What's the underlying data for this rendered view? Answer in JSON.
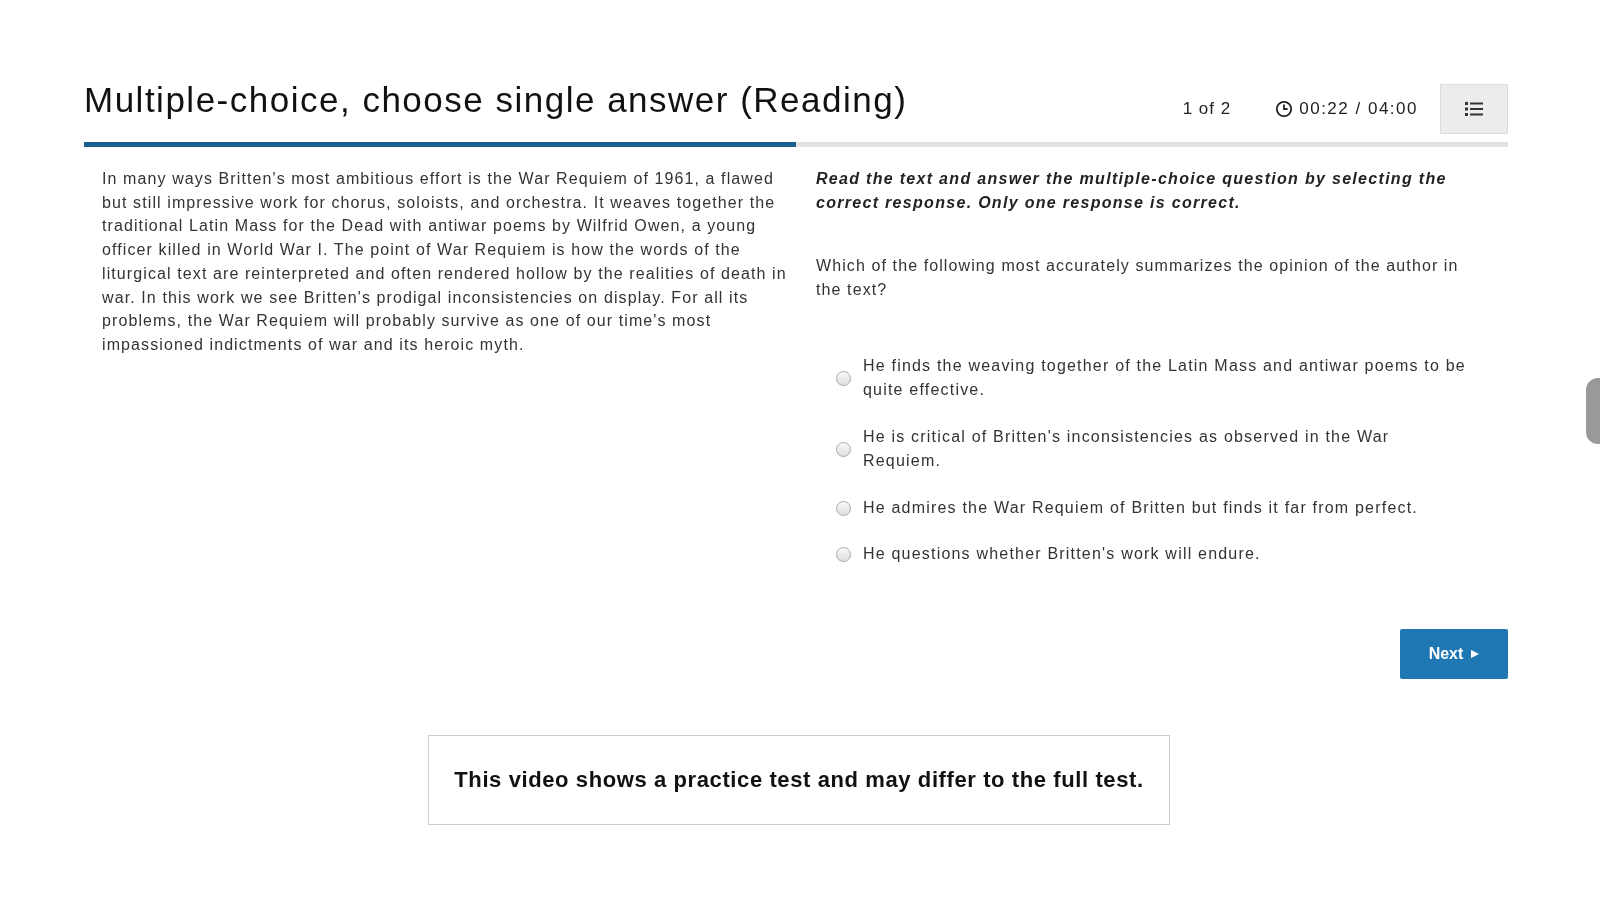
{
  "header": {
    "title": "Multiple-choice, choose single answer (Reading)",
    "counter": "1 of 2",
    "timer": "00:22 / 04:00"
  },
  "progress": {
    "level": 0.5
  },
  "passage": "In many ways Britten's most ambitious effort is the War Requiem of 1961, a flawed but still impressive work for chorus, soloists, and orchestra. It weaves together the traditional Latin Mass for the Dead with antiwar poems by Wilfrid Owen, a young officer killed in World War I. The point of War Requiem is how the words of the liturgical text are reinterpreted and often rendered hollow by the realities of death in war. In this work we see Britten's prodigal inconsistencies on display. For all its problems, the War Requiem will probably survive as one of our time's most impassioned indictments of war and its heroic myth.",
  "instructions": "Read the text and answer the multiple-choice question by selecting the correct response. Only one response is correct.",
  "question": "Which of the following most accurately summarizes the opinion of the author in the text?",
  "options": [
    {
      "label": "He finds the weaving together of the Latin Mass and antiwar poems to be quite effective.",
      "selected": false
    },
    {
      "label": "He is critical of Britten's inconsistencies as observed in the War Requiem.",
      "selected": false
    },
    {
      "label": "He admires the War Requiem of Britten but finds it far from perfect.",
      "selected": false
    },
    {
      "label": "He questions whether Britten's work will endure.",
      "selected": false
    }
  ],
  "next_button": {
    "label": "Next"
  },
  "notice": "This video shows a practice test and may differ to the full test."
}
